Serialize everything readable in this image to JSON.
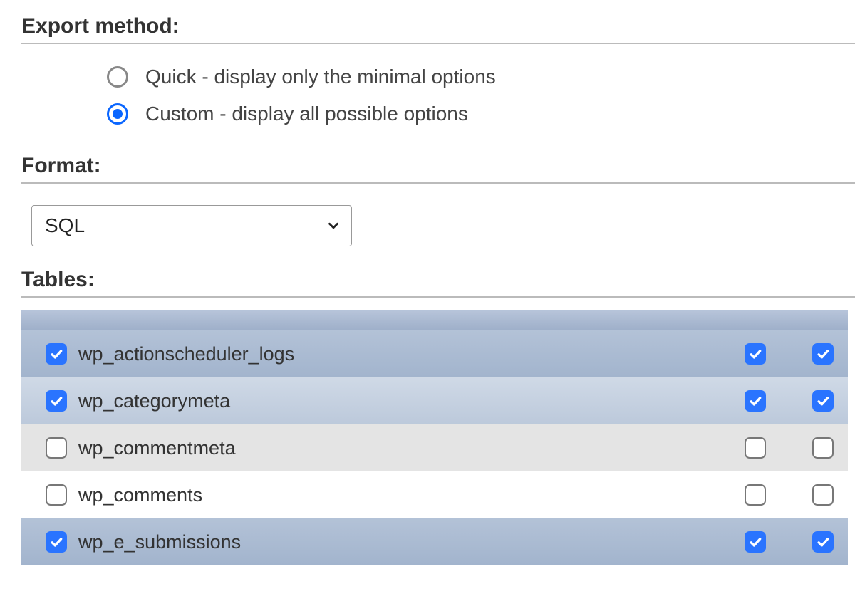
{
  "export_method": {
    "heading": "Export method:",
    "options": [
      {
        "label": "Quick - display only the minimal options",
        "selected": false
      },
      {
        "label": "Custom - display all possible options",
        "selected": true
      }
    ]
  },
  "format": {
    "heading": "Format:",
    "selected": "SQL"
  },
  "tables": {
    "heading": "Tables:",
    "rows": [
      {
        "name": "wp_actionscheduler_logs",
        "c1": true,
        "c2": true,
        "c3": true,
        "style": "sel-dark"
      },
      {
        "name": "wp_categorymeta",
        "c1": true,
        "c2": true,
        "c3": true,
        "style": "sel-light"
      },
      {
        "name": "wp_commentmeta",
        "c1": false,
        "c2": false,
        "c3": false,
        "style": "unsel-gray"
      },
      {
        "name": "wp_comments",
        "c1": false,
        "c2": false,
        "c3": false,
        "style": "unsel-white"
      },
      {
        "name": "wp_e_submissions",
        "c1": true,
        "c2": true,
        "c3": true,
        "style": "sel-dark"
      }
    ]
  }
}
